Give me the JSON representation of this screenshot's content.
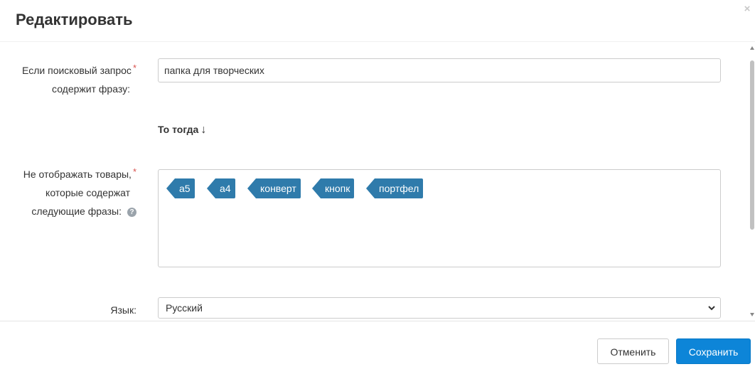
{
  "dialog": {
    "title": "Редактировать",
    "close_glyph": "×"
  },
  "form": {
    "query_label_line1": "Если поисковый запрос",
    "query_label_line2": "содержит фразу:",
    "required_mark": "*",
    "query_value": "папка для творческих",
    "then_label": "То тогда",
    "then_arrow": "↓",
    "hide_label_line1": "Не отображать товары,",
    "hide_label_line2": "которые содержат",
    "hide_label_line3": "следующие фразы:",
    "help_glyph": "?",
    "tags": [
      "а5",
      "а4",
      "конверт",
      "кнопк",
      "портфел"
    ],
    "language_label": "Язык:",
    "language_value": "Русский"
  },
  "footer": {
    "cancel_label": "Отменить",
    "save_label": "Сохранить"
  },
  "colors": {
    "tag_bg": "#2f7bab",
    "primary": "#0d85d8",
    "required": "#d9534f"
  },
  "icons": {
    "close": "close-icon",
    "help": "question-circle-icon",
    "select": "chevron-down-icon",
    "then": "arrow-down-icon"
  }
}
